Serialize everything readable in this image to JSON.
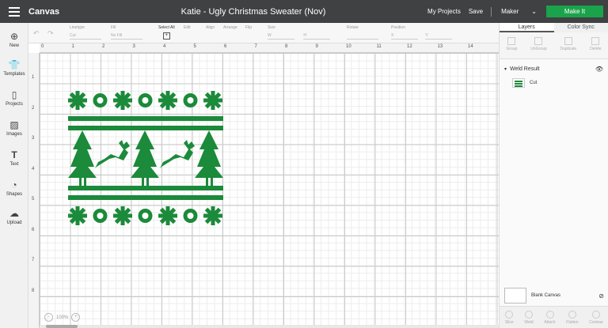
{
  "app": {
    "name": "Canvas",
    "doc_title": "Katie - Ugly Christmas Sweater (Nov)"
  },
  "header": {
    "my_projects": "My Projects",
    "save": "Save",
    "machine": "Maker",
    "make_it": "Make It"
  },
  "sidebar": {
    "items": [
      {
        "label": "New",
        "icon": "plus-circle-icon"
      },
      {
        "label": "Templates",
        "icon": "shirt-icon"
      },
      {
        "label": "Projects",
        "icon": "projects-icon"
      },
      {
        "label": "Images",
        "icon": "image-icon"
      },
      {
        "label": "Text",
        "icon": "text-icon"
      },
      {
        "label": "Shapes",
        "icon": "shapes-icon"
      },
      {
        "label": "Upload",
        "icon": "upload-icon"
      }
    ]
  },
  "toolbar": {
    "linetype_label": "Linetype",
    "linetype_value": "Cut",
    "fill_label": "Fill",
    "fill_value": "No Fill",
    "select_all": "Select All",
    "edit": "Edit",
    "align": "Align",
    "arrange": "Arrange",
    "flip": "Flip",
    "size": "Size",
    "size_w": "W",
    "size_h": "H",
    "rotate": "Rotate",
    "position": "Position",
    "pos_x": "X",
    "pos_y": "Y"
  },
  "ruler": {
    "h": [
      "0",
      "1",
      "2",
      "3",
      "4",
      "5",
      "6",
      "7",
      "8",
      "9",
      "10",
      "11",
      "12",
      "13",
      "14"
    ],
    "v": [
      "1",
      "2",
      "3",
      "4",
      "5",
      "6",
      "7",
      "8"
    ]
  },
  "zoom": {
    "minus": "−",
    "value": "100%",
    "plus": "+"
  },
  "panel": {
    "tabs": [
      "Layers",
      "Color Sync"
    ],
    "tools": [
      "Group",
      "UnGroup",
      "Duplicate",
      "Delete"
    ],
    "group_name": "Weld Result",
    "layer_name": "Cut",
    "blank_canvas": "Blank Canvas",
    "bottom_tools": [
      "Slice",
      "Weld",
      "Attach",
      "Flatten",
      "Contour"
    ]
  },
  "colors": {
    "topbar": "#3f4143",
    "make_it": "#1aa34a",
    "design_green": "#1b8a3a"
  }
}
